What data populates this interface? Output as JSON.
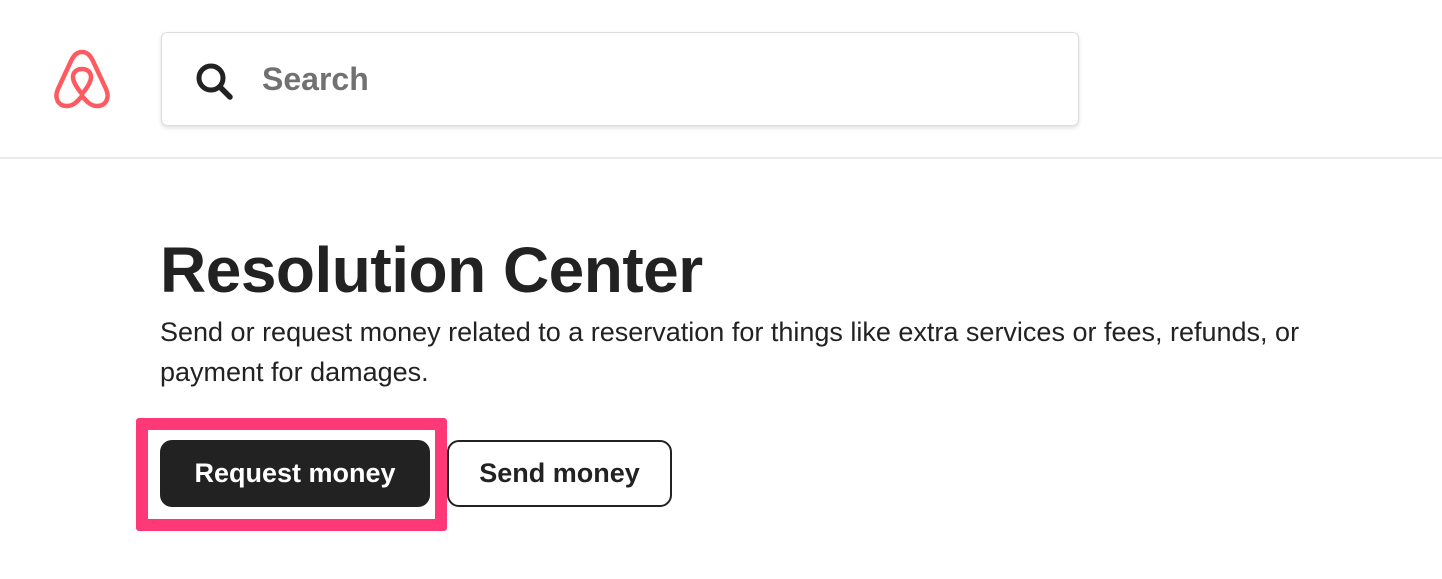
{
  "header": {
    "logo": {
      "icon": "airbnb-logo-icon",
      "color": "#ff5a5f"
    },
    "search": {
      "icon": "search-icon",
      "placeholder": "Search",
      "value": ""
    }
  },
  "main": {
    "title": "Resolution Center",
    "description": "Send or request money related to a reservation for things like extra services or fees, refunds, or payment for damages.",
    "buttons": {
      "request_money": "Request money",
      "send_money": "Send money"
    },
    "highlight_color": "#ff3877"
  }
}
